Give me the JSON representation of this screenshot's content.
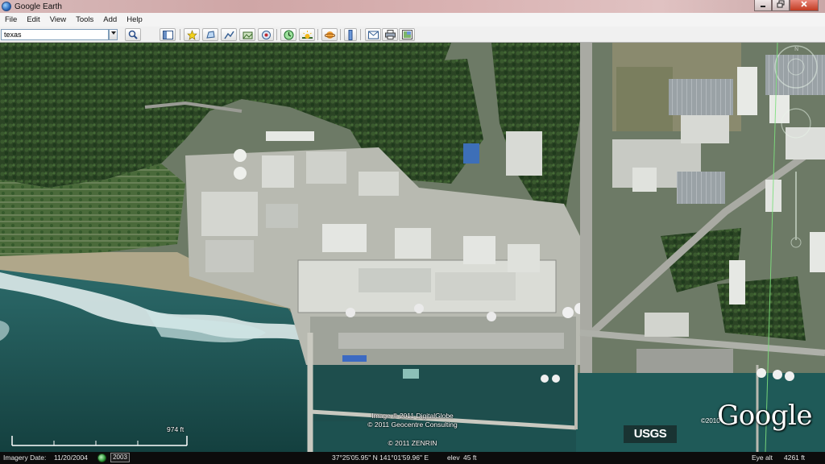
{
  "window": {
    "title": "Google Earth",
    "minimize": "0",
    "restore": "1",
    "close": "r"
  },
  "menu": {
    "items": [
      "File",
      "Edit",
      "View",
      "Tools",
      "Add",
      "Help"
    ]
  },
  "search": {
    "value": "texas"
  },
  "toolbar": {
    "buttons": [
      "sidebar-toggle",
      "placemark",
      "polygon",
      "path",
      "image-overlay",
      "tour",
      "historical-imagery",
      "sunlight",
      "planet-switcher",
      "ruler",
      "email",
      "print",
      "view-in-maps"
    ]
  },
  "map": {
    "scale_label": "974 ft",
    "credits": [
      "Image © 2011 DigitalGlobe",
      "© 2011 Geocentre Consulting",
      "© 2011 ZENRIN"
    ],
    "usgs_label": "USGS",
    "logo_year": "©2010",
    "logo_text": "Google"
  },
  "status": {
    "imagery_label": "Imagery Date:",
    "imagery_date": "11/20/2004",
    "history_year": "2003",
    "coordinates": "37°25'05.95\" N 141°01'59.96\" E",
    "elev_label": "elev",
    "elev_value": "45 ft",
    "eye_alt_label": "Eye alt",
    "eye_alt_value": "4261 ft"
  },
  "colors": {
    "sea": "#1f5a5a",
    "forest": "#2f4a2a",
    "concrete": "#c9c9c2",
    "status_bg": "#0c0c0c"
  }
}
